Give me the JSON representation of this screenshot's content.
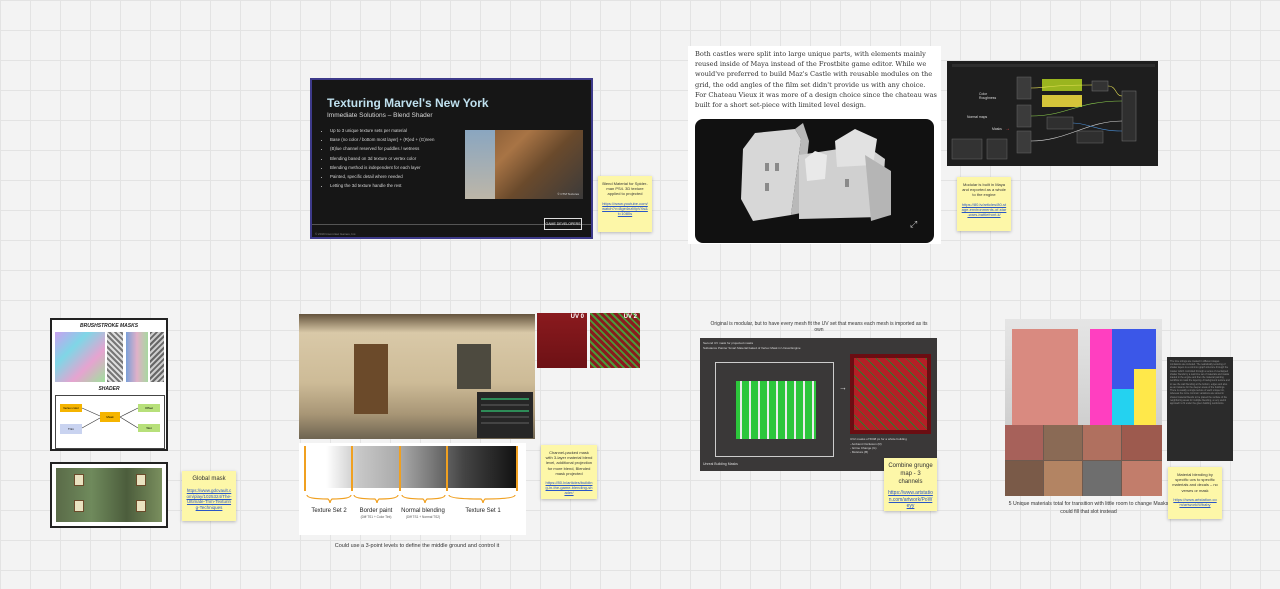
{
  "slide": {
    "title": "Texturing Marvel's New York",
    "subtitle": "Immediate Solutions – Blend Shader",
    "bullets": [
      "Up to 3 unique texture sets per material",
      "Base (no color / bottom most layer) + (R)ed + (G)reen",
      "(B)lue channel reserved for puddles / wetness",
      "Blending based on 3d texture or vertex color",
      "Blending method is independent for each layer",
      "Painted, specific detail where needed",
      "Letting the 3d texture handle the rest"
    ],
    "photo_credit": "© CTM Textures",
    "copyright": "© 2019 Insomniac Games, Inc.",
    "logo_text": "GAME DEVELOPERS"
  },
  "note_blend": {
    "text": "Blend Material for Spider-man PS4. 3D texture applied to projected",
    "link": "https://www.youtube.com/watch?v=8ge4nzMpVXs&t=1080s"
  },
  "article": {
    "paragraph": "Both castles were split into large unique parts, with elements mainly reused inside of Maya instead of the Frostbite game editor. While we would've preferred to build Maz's Castle with reusable modules on the grid, the odd angles of the film set didn't provide us with any choice. For Chateau Vieux it was more of a design choice since the chateau was built for a short set-piece with limited level design.",
    "expand_icon": "expand-icon"
  },
  "nodegraph": {
    "label_color": "Color Roughness",
    "label_normal": "Normal maps",
    "label_masks": "Masks",
    "arrow": "→"
  },
  "note_modular": {
    "text": "Modular is built in Maya and exported as a whole to the engine",
    "link": "https://80.lv/articles/80-stage-environments-of-star-wars-battlefront-ii/"
  },
  "brush": {
    "title": "BRUSHSTROKE MASKS",
    "shader_title": "SHADER",
    "node1": "Vertex color",
    "node2": "Trim",
    "node3": "Mask",
    "node4": "Offset",
    "node5": "Wet"
  },
  "note_global": {
    "text": "Global mask",
    "link": "https://www.gdcvault.com/play/1025324/The-Ultimate-Trim-Texturing-Techniques"
  },
  "uv": {
    "uv0": "UV 0",
    "uv2": "UV 2"
  },
  "gradient": {
    "labels": [
      {
        "text": "Texture Set 2",
        "sub": ""
      },
      {
        "text": "Border paint",
        "sub": "(Diff TS1 + Color Tint)"
      },
      {
        "text": "Normal blending",
        "sub": "(Diff TS1 + Normal TS2)"
      },
      {
        "text": "Texture Set 1",
        "sub": ""
      }
    ],
    "caption": "Could use a 3-point levels to define the middle ground and control it"
  },
  "note_channel": {
    "text": "Channel-packed mask with 3-layer material blend level, additional projection for more blend, Blended mask projected",
    "link": "https://80.lv/articles/building-in-the-game-blending-shader/"
  },
  "capture": {
    "caption": "Original is modular, but to have every mesh fit the UV set that means each mesh is imported as its own",
    "line1": "Second UV mask for projected masks",
    "line2": "Substance Painter Smart Material baked of Vertex Mask in Unreal Engine",
    "line3": "UV2 masks of 5048 px for a whole building",
    "line4": "- Ambient Occlusion (R)",
    "line5": "- Grime Change (G)",
    "line6": "- Moisture (B)",
    "footer": "Unreal Building Masks"
  },
  "note_combine": {
    "text": "Combine grunge map - 3 channels",
    "link": "https://www.artstation.com/artwork/PoWeyy"
  },
  "buildings": {
    "caption": "5 Unique materials total for transition with little room to change Masks could fill that slot instead"
  },
  "darknote": {
    "text": "The time strings are created in different stages. Limitations are included. The realistically texturing of shader layers is a common graph structure through the master which controlled through a series of overlapped shader blends by a real time set of materials and masks loaded in the engine and then the material painting workflow to mask the layering. A background texture and to see the wall blending at the bottom, edges and also as an instance for the deeper areas of the buildings. There is usually a single texture of each unique tint, whereas the more common variations are stored in shared material blends to be placed the surface of the neighboring areas for multiple blending, a very useful approach to fit under the given building restrictions."
  },
  "note_material": {
    "text": "Material blending by specific uvs to specific materials and decals – no verses or mask",
    "link": "https://www.artstation.com/artwork/Wbaby"
  }
}
